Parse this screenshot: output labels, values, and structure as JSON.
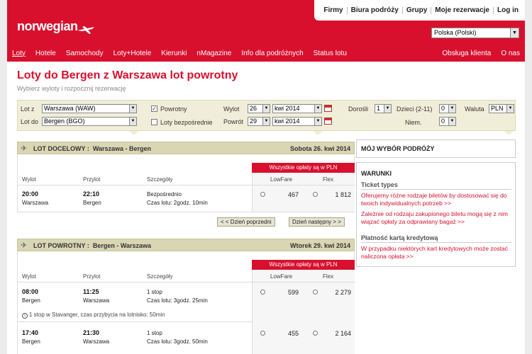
{
  "header": {
    "logo": "norwegian",
    "top_links": [
      "Firmy",
      "Biura podróży",
      "Grupy",
      "Moje rezerwacje",
      "Log in"
    ],
    "language": "Polska (Polski)",
    "nav_left": [
      "Loty",
      "Hotele",
      "Samochody",
      "Loty+Hotele",
      "Kierunki",
      "nMagazine",
      "Info dla podróżnych",
      "Status lotu"
    ],
    "nav_right": [
      "Obsługa klienta",
      "O nas"
    ]
  },
  "page": {
    "title": "Loty do Bergen z Warszawa lot powrotny",
    "subtitle": "Wybierz wyloty i rozpocznij rezerwację"
  },
  "search": {
    "from_label": "Lot z",
    "from_value": "Warszawa (WAW)",
    "to_label": "Lot do",
    "to_value": "Bergen (BGO)",
    "return_label": "Powrotny",
    "return_checked": true,
    "direct_label": "Loty bezpośrednie",
    "direct_checked": false,
    "departure_label": "Wylot",
    "departure_day": "26",
    "departure_month": "kwi 2014",
    "return_date_label": "Powrót",
    "return_day": "29",
    "return_month": "kwi 2014",
    "adults_label": "Dorośli",
    "adults_value": "1",
    "children_label": "Dzieci (2-11)",
    "children_value": "0",
    "infants_label": "Niem.",
    "infants_value": "0",
    "currency_label": "Waluta",
    "currency_value": "PLN"
  },
  "outbound": {
    "label": "LOT DOCELOWY :",
    "route": "Warszawa - Bergen",
    "date": "Sobota 26. kwi 2014",
    "fees_note": "Wszystkie opłaty są w PLN",
    "col_departure": "Wylot",
    "col_arrival": "Przylot",
    "col_details": "Szczegóły",
    "col_lowfare": "LowFare",
    "col_flex": "Flex",
    "flights": [
      {
        "dep_time": "20:00",
        "dep_city": "Warszawa",
        "arr_time": "22:10",
        "arr_city": "Bergen",
        "stops": "Bezpośrednio",
        "duration": "Czas lotu: 2godz. 10min",
        "lowfare": "467",
        "flex": "1 812"
      }
    ],
    "prev_day": "< < Dzień poprzedni",
    "next_day": "Dzień następny > >"
  },
  "return_flight": {
    "label": "LOT POWROTNY :",
    "route": "Bergen - Warszawa",
    "date": "Wtorek 29. kwi 2014",
    "fees_note": "Wszystkie opłaty są w PLN",
    "col_departure": "Wylot",
    "col_arrival": "Przylot",
    "col_details": "Szczegóły",
    "col_lowfare": "LowFare",
    "col_flex": "Flex",
    "flights": [
      {
        "dep_time": "08:00",
        "dep_city": "Bergen",
        "arr_time": "11:25",
        "arr_city": "Warszawa",
        "stops": "1 stop",
        "duration": "Czas lotu: 3godz. 25min",
        "lowfare": "599",
        "flex": "2 279",
        "note": "1 stop w Stavanger, czas przybycia na lotnisko: 50min"
      },
      {
        "dep_time": "17:40",
        "dep_city": "Bergen",
        "arr_time": "21:30",
        "arr_city": "Warszawa",
        "stops": "1 stop",
        "duration": "Czas lotu: 3godz. 50min",
        "lowfare": "455",
        "flex": "2 164"
      }
    ]
  },
  "sidebar": {
    "my_choice": "MÓJ WYBÓR PODRÓŻY",
    "conditions": "WARUNKI",
    "ticket_types_title": "Ticket types",
    "ticket_link1": "Oferujemy różne rodzaje biletów by dostosować się do twoich indywidualnych potrzeb >>",
    "ticket_link2": "Zależnie od rodzaju zakupionego biletu mogą się z nim wiązać opłaty za odprawiany bagaż >>",
    "card_title": "Płatność kartą kredytową",
    "card_link": "W przypadku niektórych kart kredytowych może zostać naliczona opłata >>"
  }
}
